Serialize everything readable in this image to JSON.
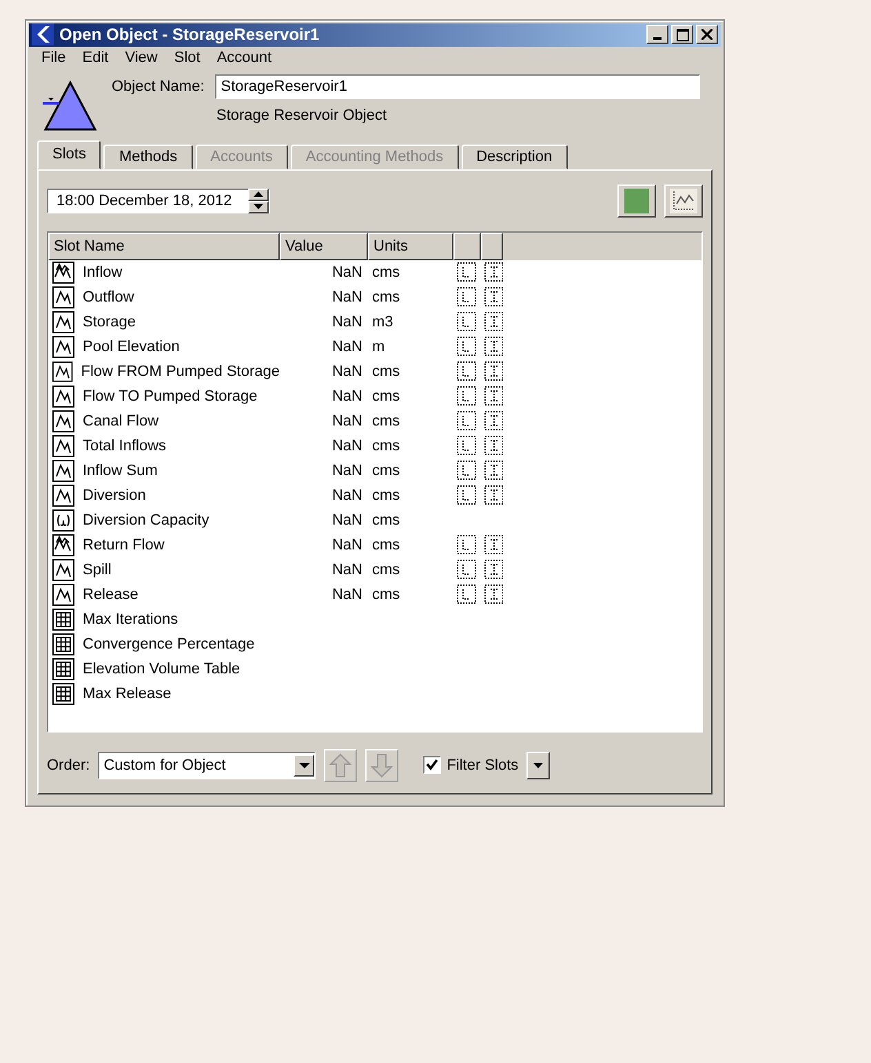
{
  "window": {
    "title": "Open Object - StorageReservoir1"
  },
  "menu": [
    "File",
    "Edit",
    "View",
    "Slot",
    "Account"
  ],
  "object": {
    "name_label": "Object Name:",
    "name": "StorageReservoir1",
    "type": "Storage Reservoir Object"
  },
  "tabs": [
    {
      "label": "Slots",
      "selected": true,
      "disabled": false
    },
    {
      "label": "Methods",
      "selected": false,
      "disabled": false
    },
    {
      "label": "Accounts",
      "selected": false,
      "disabled": true
    },
    {
      "label": "Accounting Methods",
      "selected": false,
      "disabled": true
    },
    {
      "label": "Description",
      "selected": false,
      "disabled": false
    }
  ],
  "timestep": "18:00 December 18, 2012",
  "table": {
    "columns": [
      "Slot Name",
      "Value",
      "Units"
    ],
    "rows": [
      {
        "kind": "multi",
        "name": "Inflow",
        "value": "NaN",
        "units": "cms",
        "flags": true
      },
      {
        "kind": "series",
        "name": "Outflow",
        "value": "NaN",
        "units": "cms",
        "flags": true
      },
      {
        "kind": "series",
        "name": "Storage",
        "value": "NaN",
        "units": "m3",
        "flags": true
      },
      {
        "kind": "series",
        "name": "Pool Elevation",
        "value": "NaN",
        "units": "m",
        "flags": true
      },
      {
        "kind": "series",
        "name": "Flow FROM Pumped Storage",
        "value": "NaN",
        "units": "cms",
        "flags": true
      },
      {
        "kind": "series",
        "name": "Flow TO Pumped Storage",
        "value": "NaN",
        "units": "cms",
        "flags": true
      },
      {
        "kind": "series",
        "name": "Canal Flow",
        "value": "NaN",
        "units": "cms",
        "flags": true
      },
      {
        "kind": "series",
        "name": "Total Inflows",
        "value": "NaN",
        "units": "cms",
        "flags": true
      },
      {
        "kind": "series",
        "name": "Inflow Sum",
        "value": "NaN",
        "units": "cms",
        "flags": true
      },
      {
        "kind": "series",
        "name": "Diversion",
        "value": "NaN",
        "units": "cms",
        "flags": true
      },
      {
        "kind": "scalar",
        "name": "Diversion Capacity",
        "value": "NaN",
        "units": "cms",
        "flags": false
      },
      {
        "kind": "multi",
        "name": "Return Flow",
        "value": "NaN",
        "units": "cms",
        "flags": true
      },
      {
        "kind": "series",
        "name": "Spill",
        "value": "NaN",
        "units": "cms",
        "flags": true
      },
      {
        "kind": "series",
        "name": "Release",
        "value": "NaN",
        "units": "cms",
        "flags": true
      },
      {
        "kind": "table",
        "name": "Max Iterations",
        "flags": false
      },
      {
        "kind": "table",
        "name": "Convergence Percentage",
        "flags": false
      },
      {
        "kind": "table",
        "name": "Elevation Volume Table",
        "flags": false
      },
      {
        "kind": "table",
        "name": "Max Release",
        "flags": false
      }
    ]
  },
  "order": {
    "label": "Order:",
    "value": "Custom for Object"
  },
  "filter_slots": {
    "label": "Filter Slots",
    "checked": true
  }
}
